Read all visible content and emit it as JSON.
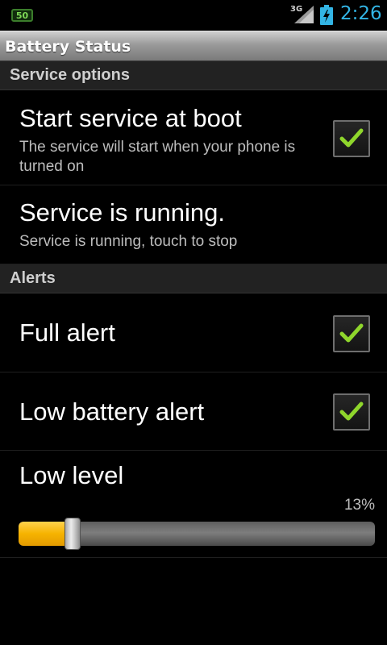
{
  "status_bar": {
    "notification_badge": "50",
    "network_type": "3G",
    "time": "2:26",
    "icons": [
      "signal-icon",
      "battery-charging-icon"
    ]
  },
  "app": {
    "title": "Battery Status"
  },
  "sections": {
    "service_options": "Service options",
    "alerts": "Alerts"
  },
  "prefs": {
    "start_at_boot": {
      "title": "Start service at boot",
      "summary": "The service will start when your phone is turned on",
      "checked": true
    },
    "service_running": {
      "title": "Service is running.",
      "summary": "Service is running, touch to stop"
    },
    "full_alert": {
      "title": "Full alert",
      "checked": true
    },
    "low_battery_alert": {
      "title": "Low battery alert",
      "checked": true
    },
    "low_level": {
      "title": "Low level",
      "value_label": "13%",
      "fraction": 0.13
    }
  },
  "colors": {
    "accent_clock": "#33b5e5",
    "checkmark": "#8fd62c",
    "slider_fill": "#f6b300"
  }
}
